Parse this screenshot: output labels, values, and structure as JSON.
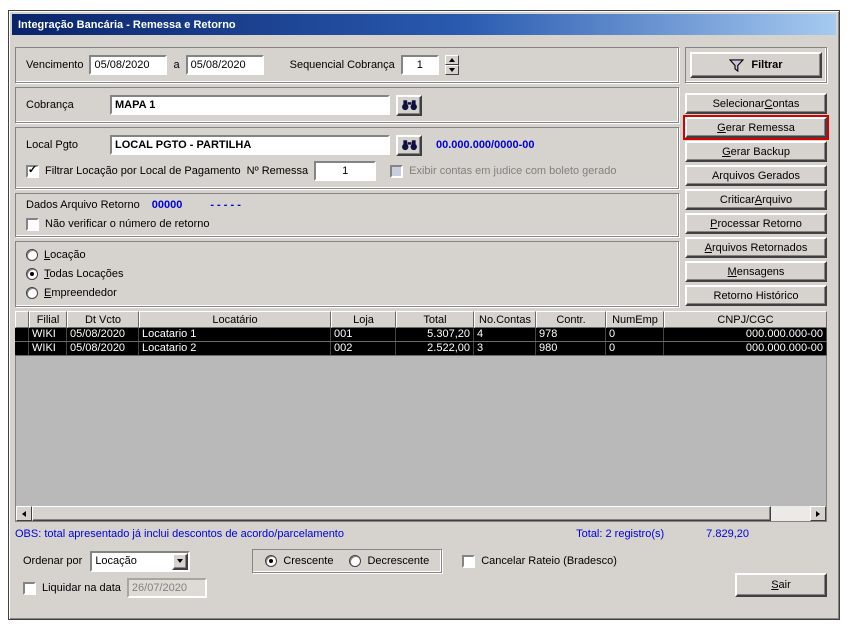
{
  "colors": {
    "accent_blue": "#0000d8",
    "highlight_red": "#d40000",
    "titlebar_gradient_start": "#0a246a",
    "titlebar_gradient_end": "#a6caf0",
    "dialog_face": "#d6d3ce",
    "selected_row_bg": "#000000"
  },
  "window": {
    "title": "Integração Bancária - Remessa e Retorno"
  },
  "filter_section": {
    "vencimento_label": "Vencimento",
    "date_from": "05/08/2020",
    "to_label": "a",
    "date_to": "05/08/2020",
    "sequencial_label": "Sequencial Cobrança",
    "sequencial_value": "1",
    "filtrar_button": "Filtrar"
  },
  "cobranca": {
    "label": "Cobrança",
    "value": "MAPA 1"
  },
  "local_pgto": {
    "label": "Local Pgto",
    "value": "LOCAL PGTO - PARTILHA",
    "cnpj": "00.000.000/0000-00",
    "filtrar_locacao_label": "Filtrar Locação por Local de Pagamento",
    "num_remessa_label": "Nº Remessa",
    "num_remessa_value": "1",
    "exibir_contas_label": "Exibir contas em judice com boleto gerado"
  },
  "dados_retorno": {
    "label": "Dados Arquivo Retorno",
    "numero": "00000",
    "detalhe": "- - - - -",
    "nao_verificar_label": "Não verificar o número de retorno"
  },
  "scope": {
    "locacao": {
      "pre": "",
      "accel": "L",
      "rest": "ocação"
    },
    "todas": {
      "pre": "",
      "accel": "T",
      "rest": "odas Locações"
    },
    "empreendedor": {
      "pre": "",
      "accel": "E",
      "rest": "mpreendedor"
    }
  },
  "side_buttons": [
    {
      "pre": "Selecionar ",
      "accel": "C",
      "rest": "ontas"
    },
    {
      "pre": "",
      "accel": "G",
      "rest": "erar Remessa"
    },
    {
      "pre": "",
      "accel": "G",
      "rest": "erar Backup"
    },
    {
      "pre": "Arquivos Gerados",
      "accel": "",
      "rest": ""
    },
    {
      "pre": "Criticar ",
      "accel": "A",
      "rest": "rquivo"
    },
    {
      "pre": "",
      "accel": "P",
      "rest": "rocessar Retorno"
    },
    {
      "pre": "",
      "accel": "A",
      "rest": "rquivos Retornados"
    },
    {
      "pre": "",
      "accel": "M",
      "rest": "ensagens"
    },
    {
      "pre": "Retorno Histórico",
      "accel": "",
      "rest": ""
    }
  ],
  "table": {
    "headers": [
      "Filial",
      "Dt Vcto",
      "Locatário",
      "Loja",
      "Total",
      "No.Contas",
      "Contr.",
      "NumEmp",
      "CNPJ/CGC"
    ],
    "rows": [
      [
        "WIKI",
        "05/08/2020",
        "Locatario 1",
        "001",
        "5.307,20",
        "4",
        "978",
        "0",
        "000.000.000-00"
      ],
      [
        "WIKI",
        "05/08/2020",
        "Locatario 2",
        "002",
        "2.522,00",
        "3",
        "980",
        "0",
        "000.000.000-00"
      ]
    ]
  },
  "summary": {
    "obs": "OBS: total apresentado já inclui descontos de acordo/parcelamento",
    "total_label": "Total: 2 registro(s)",
    "total_value": "7.829,20"
  },
  "footer": {
    "ordenar_label": "Ordenar por",
    "ordenar_value": "Locação",
    "crescente_label": "Crescente",
    "decrescente_label": "Decrescente",
    "cancelar_rateio_label": "Cancelar Rateio (Bradesco)",
    "liquidar_label": "Liquidar na data",
    "liquidar_value": "26/07/2020",
    "sair": {
      "pre": "",
      "accel": "S",
      "rest": "air"
    }
  }
}
